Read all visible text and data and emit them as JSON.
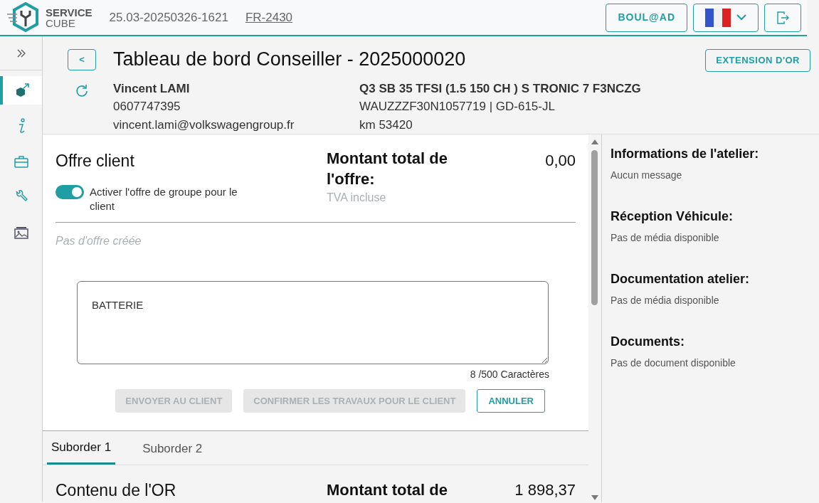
{
  "header": {
    "logo_top": "SERVICE",
    "logo_bottom": "CUBE",
    "version": "25.03-20250326-1621",
    "site_link": "FR-2430",
    "user_button": "BOUL@AD"
  },
  "sidebar": {
    "items": [
      {
        "selected": true
      },
      {
        "selected": false
      },
      {
        "selected": false
      },
      {
        "selected": false
      },
      {
        "selected": false
      }
    ]
  },
  "page": {
    "back": "<",
    "title": "Tableau de bord Conseiller - 2025000020",
    "extension_button": "EXTENSION D'OR"
  },
  "customer": {
    "name": "Vincent LAMI",
    "phone": "0607747395",
    "email": "vincent.lami@volkswagengroup.fr"
  },
  "vehicle": {
    "model": "Q3 SB 35 TFSI (1.5 150 CH ) S TRONIC 7 F3NCZG",
    "vin_plate": "WAUZZZF30N1057719 | GD-615-JL",
    "mileage": "km 53420"
  },
  "offer": {
    "title": "Offre client",
    "toggle": {
      "label": "Activer l'offre de groupe pour le client",
      "on": true
    },
    "total_label": "Montant total de l'offre:",
    "total_value": "0,00",
    "vat_note": "TVA incluse",
    "empty_note": "Pas d'offre créée",
    "comment": "BATTERIE",
    "char_count": "8 /500 Caractères",
    "buttons": [
      {
        "label": "ENVOYER AU CLIENT",
        "disabled": true
      },
      {
        "label": "CONFIRMER LES TRAVAUX POUR LE CLIENT",
        "disabled": true
      },
      {
        "label": "ANNULER",
        "disabled": false
      }
    ]
  },
  "suborders": {
    "tabs": [
      {
        "label": "Suborder 1",
        "selected": true
      },
      {
        "label": "Suborder 2",
        "selected": false
      }
    ],
    "content_title": "Contenu de l'OR",
    "total_label": "Montant total de",
    "total_value": "1 898,37"
  },
  "info_panel": [
    {
      "title": "Informations de l'atelier:",
      "text": "Aucun message"
    },
    {
      "title": "Réception Véhicule:",
      "text": "Pas de média disponible"
    },
    {
      "title": "Documentation atelier:",
      "text": "Pas de média disponible"
    },
    {
      "title": "Documents:",
      "text": "Pas de document disponible"
    }
  ]
}
